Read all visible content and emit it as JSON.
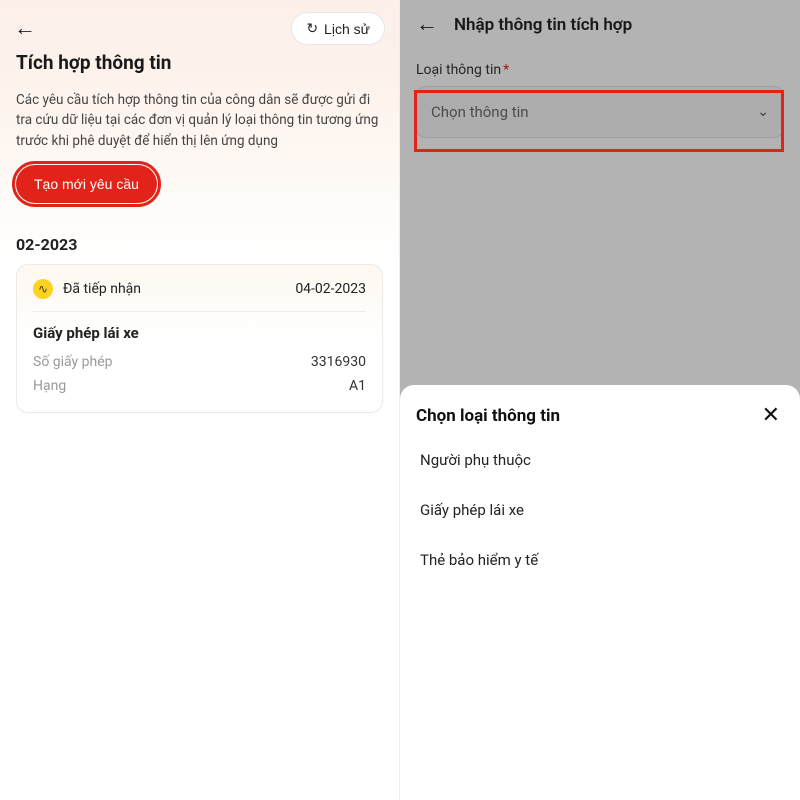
{
  "left": {
    "history_btn": "Lịch sử",
    "title": "Tích hợp thông tin",
    "desc": "Các yêu cầu tích hợp thông tin của công dân sẽ được gửi đi tra cứu dữ liệu tại các đơn vị quản lý loại thông tin tương ứng trước khi phê duyệt để hiển thị lên ứng dụng",
    "create_btn": "Tạo mới yêu cầu",
    "section_date": "02-2023",
    "card": {
      "status": "Đã tiếp nhận",
      "date": "04-02-2023",
      "title": "Giấy phép lái xe",
      "rows": [
        {
          "k": "Số giấy phép",
          "v": "3316930"
        },
        {
          "k": "Hạng",
          "v": "A1"
        }
      ]
    }
  },
  "right": {
    "header_title": "Nhập thông tin tích hợp",
    "field_label": "Loại thông tin",
    "dropdown_placeholder": "Chọn thông tin",
    "sheet": {
      "title": "Chọn loại thông tin",
      "items": [
        "Người phụ thuộc",
        "Giấy phép lái xe",
        "Thẻ bảo hiểm y tế"
      ]
    }
  }
}
